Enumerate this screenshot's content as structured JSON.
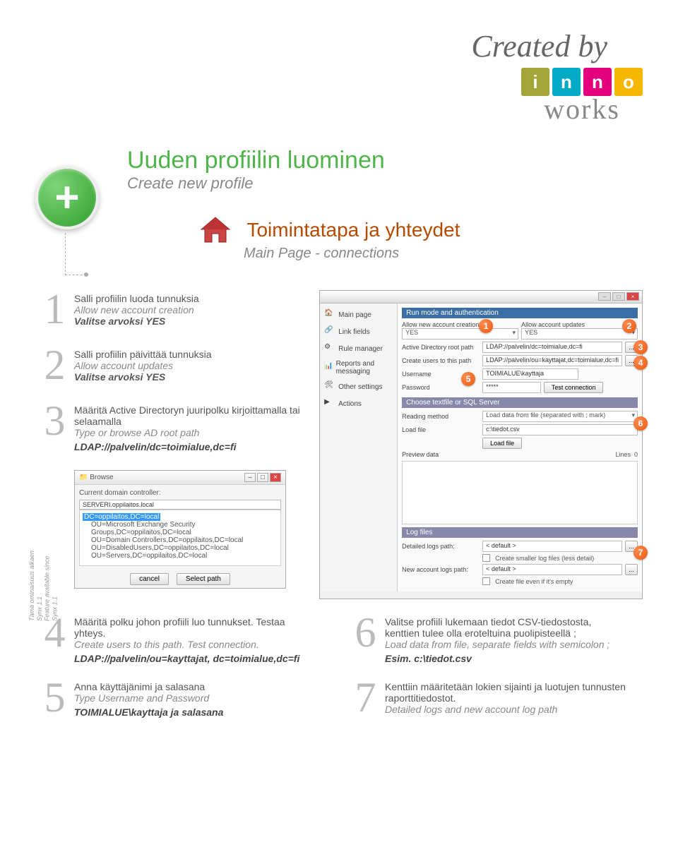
{
  "header": {
    "created_by": "Created by",
    "logo_letters": [
      "i",
      "n",
      "n",
      "o"
    ],
    "logo_word": "works"
  },
  "title": {
    "fin": "Uuden profiilin luominen",
    "eng": "Create new profile"
  },
  "section": {
    "fin": "Toimintatapa ja yhteydet",
    "eng": "Main Page - connections"
  },
  "side_note": {
    "fin": "Tämä ominaisuus alkaen Synx 1.1",
    "eng": "Feature available since Synx 1.1"
  },
  "steps_left": [
    {
      "num": "1",
      "fin": "Salli profiilin luoda tunnuksia",
      "eng": "Allow new account creation",
      "val": "Valitse arvoksi YES"
    },
    {
      "num": "2",
      "fin": "Salli profiilin päivittää tunnuksia",
      "eng": "Allow account updates",
      "val": "Valitse arvoksi YES"
    },
    {
      "num": "3",
      "fin": "Määritä Active Directoryn juuripolku kirjoittamalla tai selaamalla",
      "eng": "Type or browse AD root path",
      "code": "LDAP://palvelin/dc=toimialue,dc=fi"
    }
  ],
  "browse": {
    "title": "Browse",
    "label": "Current domain controller:",
    "server": "SERVERI.oppilaitos.local",
    "sel": "DC=oppilaitos,DC=local",
    "items": [
      "OU=Microsoft Exchange Security Groups,DC=oppilaitos,DC=local",
      "OU=Domain Controllers,DC=oppilaitos,DC=local",
      "OU=DisabledUsers,DC=oppilaitos,DC=local",
      "OU=Servers,DC=oppilaitos,DC=local"
    ],
    "cancel": "cancel",
    "select": "Select path"
  },
  "screenshot": {
    "nav": [
      "Main page",
      "Link fields",
      "Rule manager",
      "Reports and messaging",
      "Other settings",
      "Actions"
    ],
    "sec1": "Run mode and authentication",
    "allow_creation": "Allow new account creation",
    "allow_creation_val": "YES",
    "allow_updates": "Allow account updates",
    "allow_updates_val": "YES",
    "ad_root": "Active Directory root path",
    "ad_root_val": "LDAP://palvelin/dc=toimialue,dc=fi",
    "create_users": "Create users to this path",
    "create_users_val": "LDAP://palvelin/ou=kayttajat,dc=toimialue,dc=fi",
    "username": "Username",
    "username_val": "TOIMIALUE\\kayttaja",
    "password": "Password",
    "password_val": "*****",
    "test_conn": "Test connection",
    "sec2": "Choose textfile or SQL Server",
    "reading": "Reading method",
    "reading_val": "Load data from file (separated with ; mark)",
    "load_file": "Load file",
    "load_file_val": "c:\\tiedot.csv",
    "load_btn": "Load file",
    "preview": "Preview data",
    "lines": "Lines",
    "lines_val": "0",
    "sec3": "Log files",
    "detailed": "Detailed logs path:",
    "detailed_val": "< default >",
    "create_smaller": "Create smaller log files (less detail)",
    "newacc": "New account logs path:",
    "newacc_val": "< default >",
    "create_even": "Create file even if it's empty"
  },
  "steps_bottom": [
    {
      "num": "4",
      "fin": "Määritä polku johon profiili luo tunnukset. Testaa yhteys.",
      "eng": "Create users to this path. Test connection.",
      "code": "LDAP://palvelin/ou=kayttajat, dc=toimialue,dc=fi"
    },
    {
      "num": "6",
      "fin": "Valitse profiili lukemaan tiedot CSV-tiedostosta, kenttien tulee olla eroteltuina puolipisteellä ;",
      "eng": "Load data from file, separate fields with semicolon ;",
      "code": "Esim. c:\\tiedot.csv"
    },
    {
      "num": "5",
      "fin": "Anna käyttäjänimi ja salasana",
      "eng": "Type Username and Password",
      "code": "TOIMIALUE\\kayttaja ja salasana"
    },
    {
      "num": "7",
      "fin": "Kenttiin määritetään lokien sijainti ja luotujen tunnusten raporttitiedostot.",
      "eng": "Detailed logs and new account log path"
    }
  ]
}
